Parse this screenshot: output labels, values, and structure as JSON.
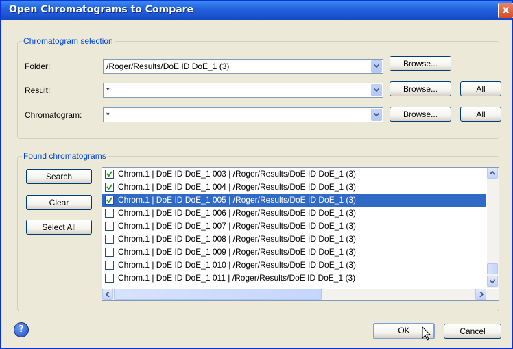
{
  "window": {
    "title": "Open Chromatograms to Compare",
    "close_glyph": "x"
  },
  "selection": {
    "legend": "Chromatogram selection",
    "folder": {
      "label": "Folder:",
      "value": "/Roger/Results/DoE ID DoE_1 (3)",
      "browse": "Browse..."
    },
    "result": {
      "label": "Result:",
      "value": "*",
      "browse": "Browse...",
      "all": "All"
    },
    "chromatogram": {
      "label": "Chromatogram:",
      "value": "*",
      "browse": "Browse...",
      "all": "All"
    }
  },
  "found": {
    "legend": "Found chromatograms",
    "buttons": {
      "search": "Search",
      "clear": "Clear",
      "select_all": "Select All"
    },
    "items": [
      {
        "text": "Chrom.1 | DoE ID DoE_1 003 | /Roger/Results/DoE ID DoE_1 (3)",
        "checked": true,
        "selected": false
      },
      {
        "text": "Chrom.1 | DoE ID DoE_1 004 | /Roger/Results/DoE ID DoE_1 (3)",
        "checked": true,
        "selected": false
      },
      {
        "text": "Chrom.1 | DoE ID DoE_1 005 | /Roger/Results/DoE ID DoE_1 (3)",
        "checked": true,
        "selected": true
      },
      {
        "text": "Chrom.1 | DoE ID DoE_1 006 | /Roger/Results/DoE ID DoE_1 (3)",
        "checked": false,
        "selected": false
      },
      {
        "text": "Chrom.1 | DoE ID DoE_1 007 | /Roger/Results/DoE ID DoE_1 (3)",
        "checked": false,
        "selected": false
      },
      {
        "text": "Chrom.1 | DoE ID DoE_1 008 | /Roger/Results/DoE ID DoE_1 (3)",
        "checked": false,
        "selected": false
      },
      {
        "text": "Chrom.1 | DoE ID DoE_1 009 | /Roger/Results/DoE ID DoE_1 (3)",
        "checked": false,
        "selected": false
      },
      {
        "text": "Chrom.1 | DoE ID DoE_1 010 | /Roger/Results/DoE ID DoE_1 (3)",
        "checked": false,
        "selected": false
      },
      {
        "text": "Chrom.1 | DoE ID DoE_1 011 | /Roger/Results/DoE ID DoE_1 (3)",
        "checked": false,
        "selected": false
      }
    ]
  },
  "footer": {
    "ok": "OK",
    "cancel": "Cancel",
    "help_glyph": "?"
  },
  "icons": {
    "help": "help-icon",
    "close": "close-icon",
    "dropdown": "chevron-down-icon",
    "cursor": "mouse-pointer-icon"
  },
  "colors": {
    "title_bar": "#2563de",
    "dialog_bg": "#ece9d8",
    "selection": "#316ac5",
    "legend_text": "#0046d5"
  }
}
